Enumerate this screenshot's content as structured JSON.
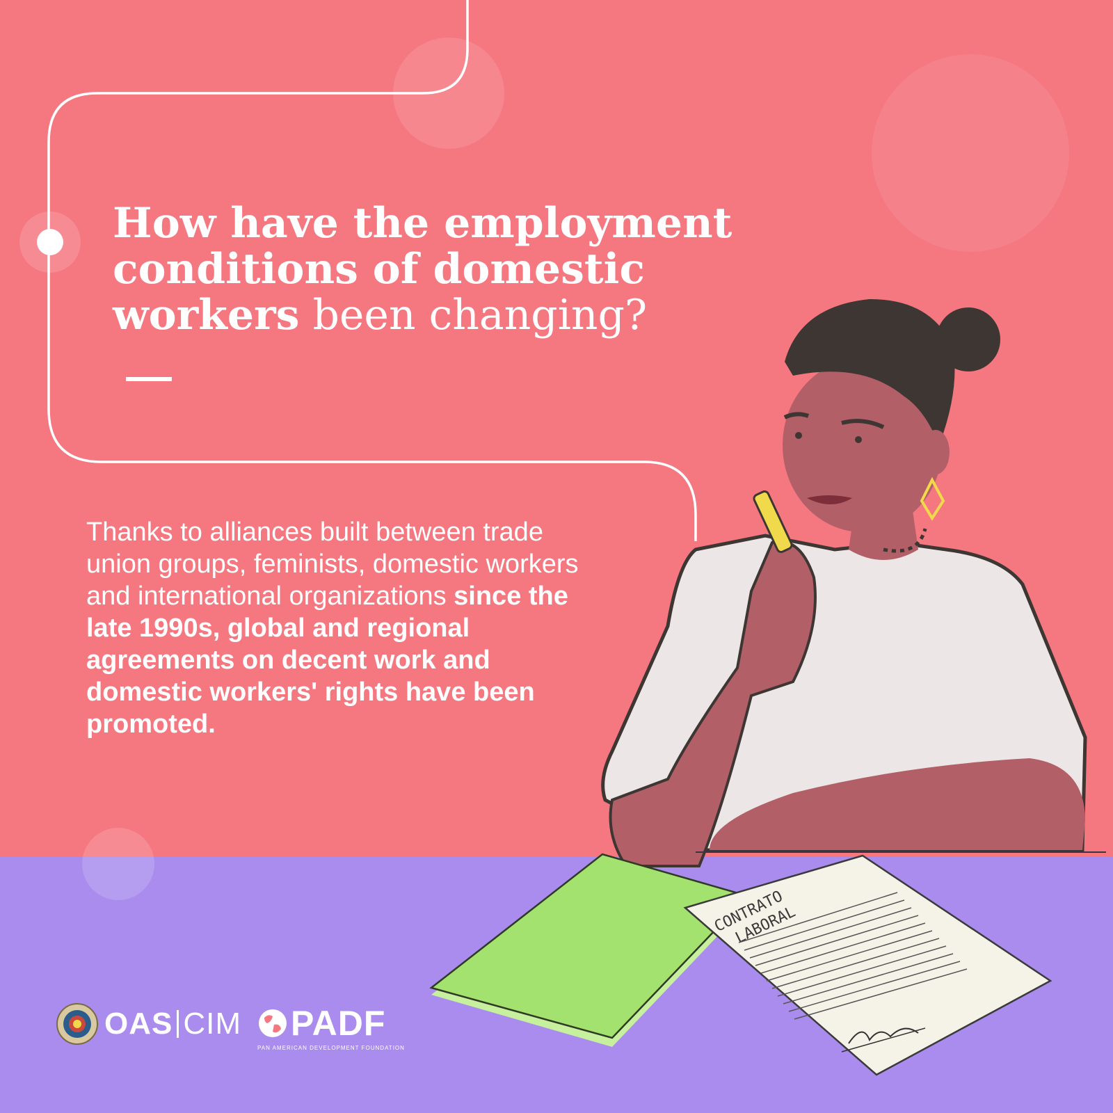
{
  "heading": {
    "bold_part": "How have the employment conditions of domestic workers",
    "regular_part": "been changing?"
  },
  "body": {
    "regular_part": "Thanks to alliances built between trade union groups, feminists, domestic workers and international organizations",
    "bold_part": "since the late 1990s, global and regional agreements on decent work and domestic workers' rights have been promoted."
  },
  "illustration": {
    "contract_label_line1": "CONTRATO",
    "contract_label_line2": "LABORAL"
  },
  "logos": {
    "oas": "OAS",
    "cim": "CIM",
    "padf": "PADF",
    "padf_full": "PAN AMERICAN DEVELOPMENT FOUNDATION"
  },
  "colors": {
    "background_top": "#f57780",
    "background_table": "#a98ced",
    "notebook": "#a3e26f",
    "shirt": "#ece6e6",
    "skin": "#b35f68",
    "hair": "#3d3633",
    "earring": "#f0d94a"
  }
}
